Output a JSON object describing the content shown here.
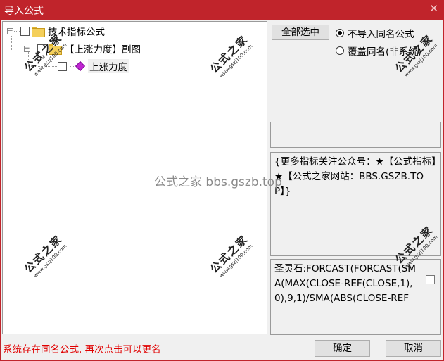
{
  "window": {
    "title": "导入公式",
    "close_glyph": "✕"
  },
  "tree": {
    "root_label": "技术指标公式",
    "child_label": "【上涨力度】副图",
    "leaf_label": "上涨力度",
    "expander_minus": "−"
  },
  "controls": {
    "select_all": "全部选中",
    "radio_skip": "不导入同名公式",
    "radio_overwrite": "覆盖同名(非系统)",
    "confirm": "确定",
    "cancel": "取消"
  },
  "info": {
    "description": "{更多指标关注公众号：★【公式指标】★【公式之家网站：BBS.GSZB.TOP】}",
    "formula": "圣灵石:FORCAST(FORCAST(SMA(MAX(CLOSE-REF(CLOSE,1),0),9,1)/SMA(ABS(CLOSE-REF"
  },
  "status": {
    "message": "系统存在同名公式, 再次点击可以更名"
  },
  "watermark": {
    "center_text": "公式之家 bbs.gszb.top",
    "stamp_text": "公式之家",
    "stamp_url": "www.gszj100.com"
  }
}
